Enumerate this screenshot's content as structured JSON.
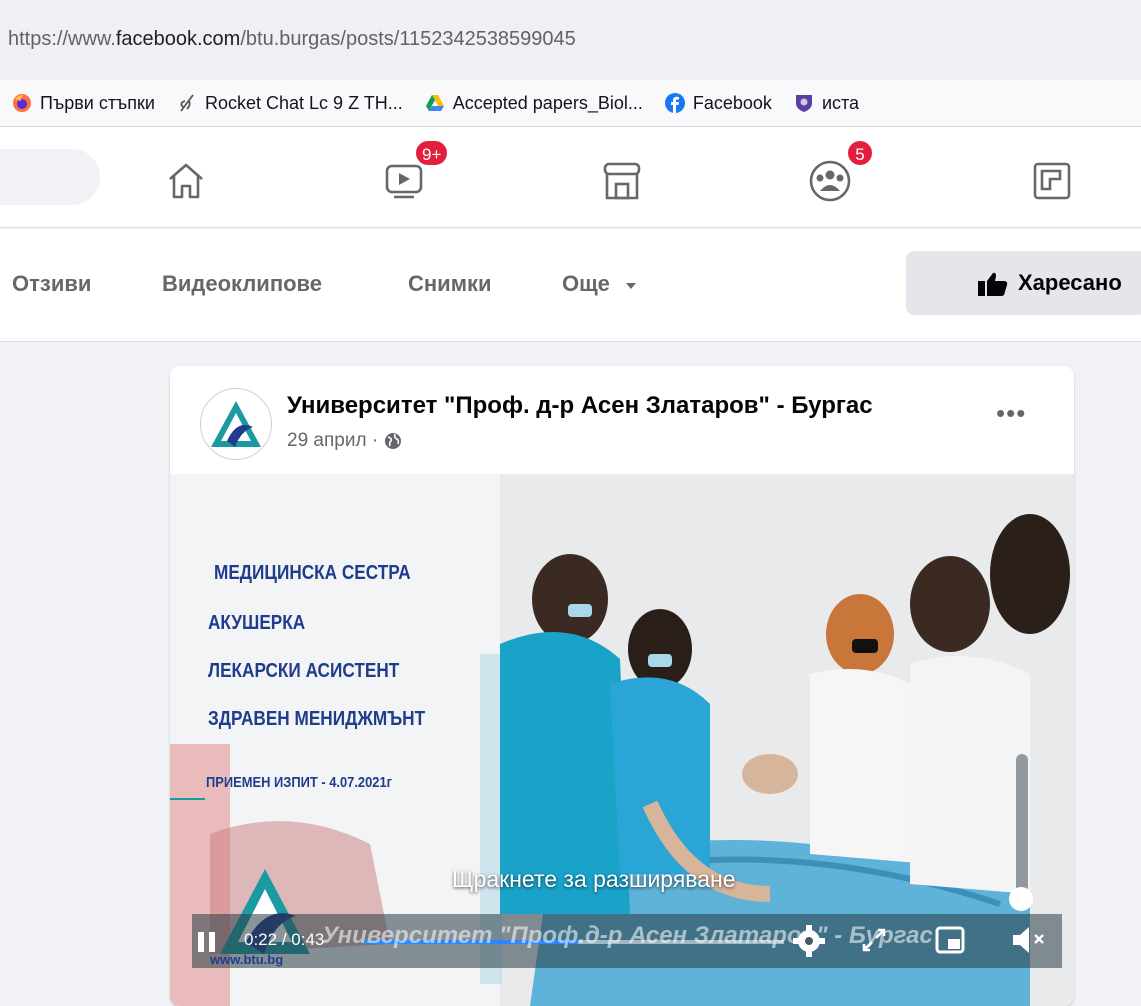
{
  "browser": {
    "url_prefix": "https://www.",
    "url_domain": "facebook.com",
    "url_path": "/btu.burgas/posts/1152342538599045",
    "bookmarks": [
      {
        "label": "Първи стъпки",
        "icon": "firefox-icon"
      },
      {
        "label": "Rocket Chat Lc 9 Z TH...",
        "icon": "rocket-chat-icon"
      },
      {
        "label": "Accepted papers_Biol...",
        "icon": "google-drive-icon"
      },
      {
        "label": "Facebook",
        "icon": "facebook-icon"
      },
      {
        "label": "иста",
        "icon": "shield-icon"
      }
    ]
  },
  "nav": {
    "watch_badge": "9+",
    "groups_badge": "5"
  },
  "page_tabs": {
    "reviews": "Отзиви",
    "videos": "Видеоклипове",
    "photos": "Снимки",
    "more": "Още",
    "liked": "Харесано"
  },
  "post": {
    "author": "Университет \"Проф. д-р Асен Златаров\" - Бургас",
    "date": "29 април · "
  },
  "video": {
    "lines": [
      "МЕДИЦИНСКА СЕСТРА",
      "АКУШЕРКА",
      "ЛЕКАРСКИ АСИСТЕНТ",
      "ЗДРАВЕН МЕНИДЖМЪНТ"
    ],
    "exam": "ПРИЕМЕН ИЗПИТ - 4.07.2021г",
    "expand_hint": "Щракнете за разширяване",
    "current_time": "0:22",
    "separator": " / ",
    "duration": "0:43",
    "progress_fraction": 0.51,
    "watermark": "Университет \"Проф.д-р Асен Златаров\" - Бургас",
    "website": "www.btu.bg",
    "accent_color": "#2d88ff"
  },
  "colors": {
    "badge": "#e41e3f",
    "secondary_text": "#65676b",
    "logo_teal": "#1b9aa0",
    "logo_blue": "#1f3d8c"
  }
}
